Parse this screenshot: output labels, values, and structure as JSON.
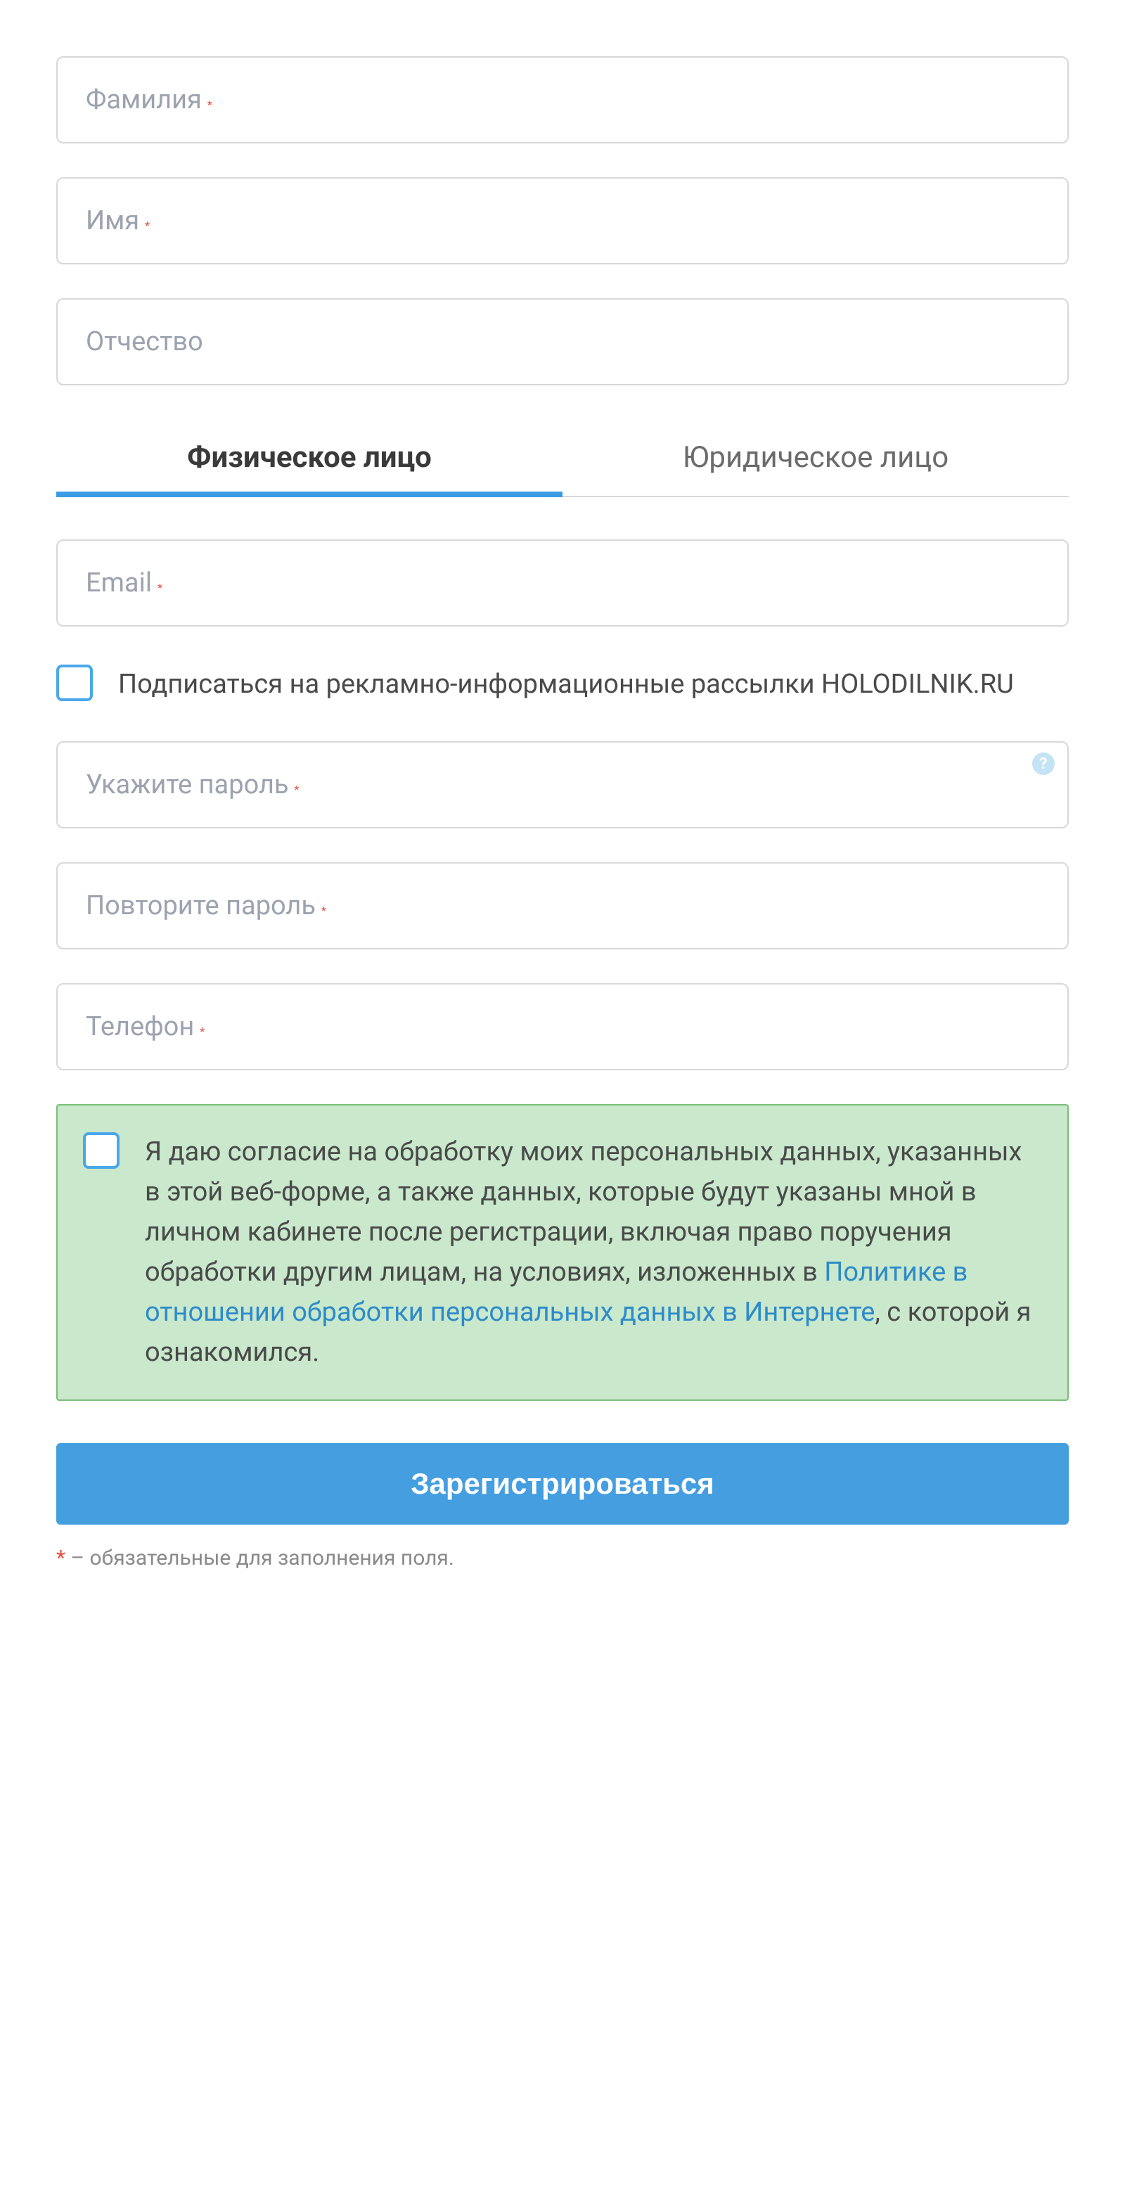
{
  "fields": {
    "lastname": {
      "label": "Фамилия",
      "required": true
    },
    "firstname": {
      "label": "Имя",
      "required": true
    },
    "patronymic": {
      "label": "Отчество",
      "required": false
    },
    "email": {
      "label": "Email",
      "required": true
    },
    "password": {
      "label": "Укажите пароль",
      "required": true
    },
    "password_repeat": {
      "label": "Повторите пароль",
      "required": true
    },
    "phone": {
      "label": "Телефон",
      "required": true
    }
  },
  "tabs": {
    "individual": "Физическое лицо",
    "legal": "Юридическое лицо"
  },
  "checkboxes": {
    "subscribe": "Подписаться на рекламно-информационные рассылки HOLODILNIK.RU"
  },
  "consent": {
    "text_before": "Я даю согласие на обработку моих персональных данных, указанных в этой веб-форме, а также данных, которые будут указаны мной в личном кабинете после регистрации, включая право поручения обработки другим лицам, на условиях, изложенных в ",
    "link": "Политике в отношении обработки персональных данных в Интернете",
    "text_after": ", с которой я ознакомился."
  },
  "submit_label": "Зарегистрироваться",
  "required_mark": "*",
  "footnote": {
    "mark": "*",
    "text": " – обязательные для заполнения поля."
  },
  "help_icon": "?"
}
